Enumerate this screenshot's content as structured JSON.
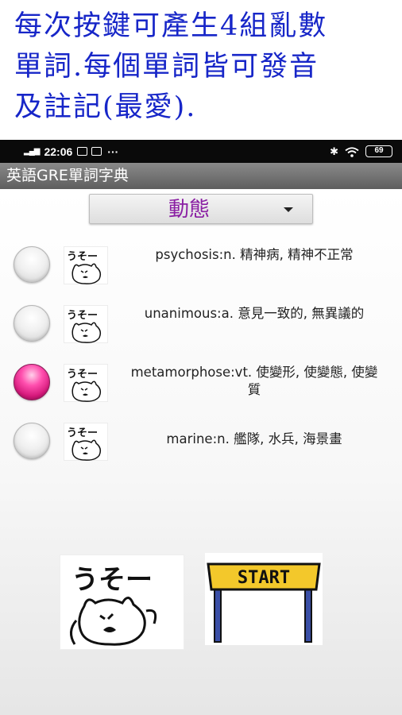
{
  "promo": {
    "line1": "每次按鍵可產生4組亂數",
    "line2": "單詞.每個單詞皆可發音",
    "line3": "及註記(最愛)."
  },
  "status_bar": {
    "time": "22:06",
    "battery": "69",
    "dots": "···"
  },
  "app": {
    "title": "英語GRE單詞字典"
  },
  "spinner": {
    "selected": "動態"
  },
  "words": [
    {
      "text": "psychosis:n. 精神病, 精神不正常",
      "checked": false,
      "icon": "usoo-cat-icon"
    },
    {
      "text": "unanimous:a. 意見一致的, 無異議的",
      "checked": false,
      "icon": "usoo-cat-icon"
    },
    {
      "text": "metamorphose:vt. 使變形, 使變態, 使變質",
      "checked": true,
      "icon": "usoo-cat-icon"
    },
    {
      "text": "marine:n. 艦隊, 水兵, 海景畫",
      "checked": false,
      "icon": "usoo-cat-icon"
    }
  ],
  "buttons": {
    "start_label": "START",
    "cat_caption": "うそー"
  },
  "colors": {
    "promo_text": "#1726c8",
    "spinner_text": "#8a1fa3",
    "radio_checked": "#d4187a",
    "start_sign": "#f3c82b"
  }
}
